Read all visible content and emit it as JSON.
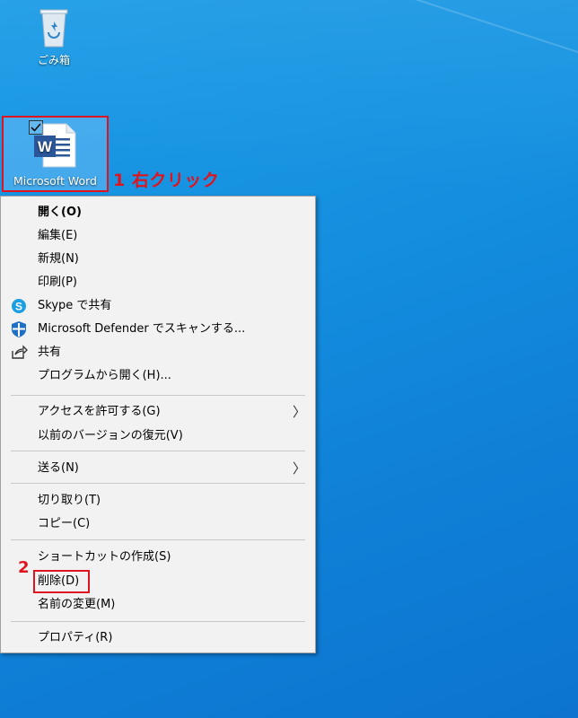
{
  "desktop": {
    "recycle_bin_label": "ごみ箱",
    "word_file_label": "Microsoft Word"
  },
  "annotations": {
    "step1": "1 右クリック",
    "step2": "2"
  },
  "context_menu": {
    "items": [
      {
        "label": "開く(O)"
      },
      {
        "label": "編集(E)"
      },
      {
        "label": "新規(N)"
      },
      {
        "label": "印刷(P)"
      },
      {
        "label": "Skype で共有"
      },
      {
        "label": "Microsoft Defender でスキャンする..."
      },
      {
        "label": "共有"
      },
      {
        "label": "プログラムから開く(H)..."
      },
      {
        "label": "アクセスを許可する(G)"
      },
      {
        "label": "以前のバージョンの復元(V)"
      },
      {
        "label": "送る(N)"
      },
      {
        "label": "切り取り(T)"
      },
      {
        "label": "コピー(C)"
      },
      {
        "label": "ショートカットの作成(S)"
      },
      {
        "label": "削除(D)"
      },
      {
        "label": "名前の変更(M)"
      },
      {
        "label": "プロパティ(R)"
      }
    ]
  },
  "colors": {
    "annotation_red": "#e0141e",
    "desktop_blue": "#1591e0",
    "menu_bg": "#f2f2f2"
  }
}
